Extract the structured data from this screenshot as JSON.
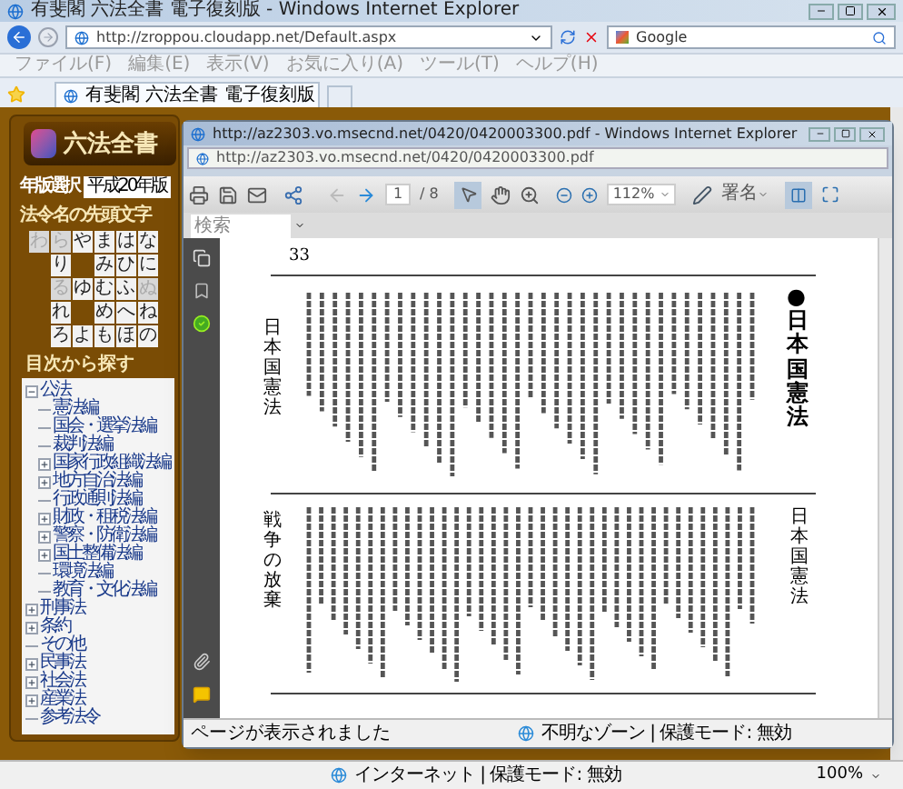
{
  "window": {
    "title": "有斐閣 六法全書 電子復刻版 - Windows Internet Explorer"
  },
  "address_bar": {
    "url": "http://zroppou.cloudapp.net/Default.aspx"
  },
  "search_box": {
    "provider": "Google"
  },
  "menu": [
    "ファイル(F)",
    "編集(E)",
    "表示(V)",
    "お気に入り(A)",
    "ツール(T)",
    "ヘルプ(H)"
  ],
  "tabs": [
    {
      "label": "有斐閣 六法全書 電子復刻版",
      "selected": true
    }
  ],
  "site": {
    "logo": "六法全書",
    "edition_label": "年版選択",
    "edition": "平成20年版",
    "kana_heading": "法令名の先頭文字",
    "kana_rows": [
      [
        {
          "kind": "key",
          "label": "わ",
          "disabled": true
        },
        {
          "kind": "key",
          "label": "ら",
          "disabled": true
        },
        {
          "kind": "key",
          "label": "や",
          "disabled": false
        },
        {
          "kind": "key",
          "label": "ま",
          "disabled": false
        },
        {
          "kind": "key",
          "label": "は",
          "disabled": false
        },
        {
          "kind": "key",
          "label": "な",
          "disabled": false
        }
      ],
      [
        {
          "kind": "gap"
        },
        {
          "kind": "key",
          "label": "り",
          "disabled": false
        },
        {
          "kind": "gap"
        },
        {
          "kind": "key",
          "label": "み",
          "disabled": false
        },
        {
          "kind": "key",
          "label": "ひ",
          "disabled": false
        },
        {
          "kind": "key",
          "label": "に",
          "disabled": false
        }
      ],
      [
        {
          "kind": "gap"
        },
        {
          "kind": "key",
          "label": "る",
          "disabled": true
        },
        {
          "kind": "key",
          "label": "ゆ",
          "disabled": false
        },
        {
          "kind": "key",
          "label": "む",
          "disabled": false
        },
        {
          "kind": "key",
          "label": "ふ",
          "disabled": false
        },
        {
          "kind": "key",
          "label": "ぬ",
          "disabled": true
        }
      ],
      [
        {
          "kind": "gap"
        },
        {
          "kind": "key",
          "label": "れ",
          "disabled": false
        },
        {
          "kind": "gap"
        },
        {
          "kind": "key",
          "label": "め",
          "disabled": false
        },
        {
          "kind": "key",
          "label": "へ",
          "disabled": false
        },
        {
          "kind": "key",
          "label": "ね",
          "disabled": false
        }
      ],
      [
        {
          "kind": "gap"
        },
        {
          "kind": "key",
          "label": "ろ",
          "disabled": false
        },
        {
          "kind": "key",
          "label": "よ",
          "disabled": false
        },
        {
          "kind": "key",
          "label": "も",
          "disabled": false
        },
        {
          "kind": "key",
          "label": "ほ",
          "disabled": false
        },
        {
          "kind": "key",
          "label": "の",
          "disabled": false
        }
      ]
    ],
    "toc_heading": "目次から探す",
    "tree": [
      {
        "label": "公法",
        "expanded": true,
        "children": [
          {
            "label": "憲法編"
          },
          {
            "label": "国会・選挙法編"
          },
          {
            "label": "裁判法編"
          },
          {
            "label": "国家行政組織法編",
            "expanded": false
          },
          {
            "label": "地方自治法編",
            "expanded": false
          },
          {
            "label": "行政通則法編"
          },
          {
            "label": "財政・租税法編",
            "expanded": false
          },
          {
            "label": "警察・防衛法編",
            "expanded": false
          },
          {
            "label": "国土整備法編",
            "expanded": false
          },
          {
            "label": "環境法編"
          },
          {
            "label": "教育・文化法編"
          }
        ]
      },
      {
        "label": "刑事法",
        "expanded": false
      },
      {
        "label": "条約",
        "expanded": false
      },
      {
        "label": "その他"
      },
      {
        "label": "民事法",
        "expanded": false
      },
      {
        "label": "社会法",
        "expanded": false
      },
      {
        "label": "産業法",
        "expanded": false
      },
      {
        "label": "参考法令"
      }
    ]
  },
  "popup": {
    "title": "http://az2303.vo.msecnd.net/0420/0420003300.pdf - Windows Internet Explorer",
    "url": "http://az2303.vo.msecnd.net/0420/0420003300.pdf",
    "toolbar": {
      "page": "1",
      "page_total": "/ 8",
      "zoom": "112%",
      "sign": "署名"
    },
    "search": {
      "placeholder": "検索"
    },
    "document": {
      "page_number": "33",
      "title": "●日本国憲法",
      "header": "日本国憲法",
      "running_head": "日本国憲法",
      "chapter": "戦争の放棄"
    },
    "status": "ページが表示されました",
    "zone": "不明なゾーン | 保護モード: 無効"
  },
  "status_bar": {
    "zone": "インターネット | 保護モード: 無効",
    "zoom": "100%"
  }
}
